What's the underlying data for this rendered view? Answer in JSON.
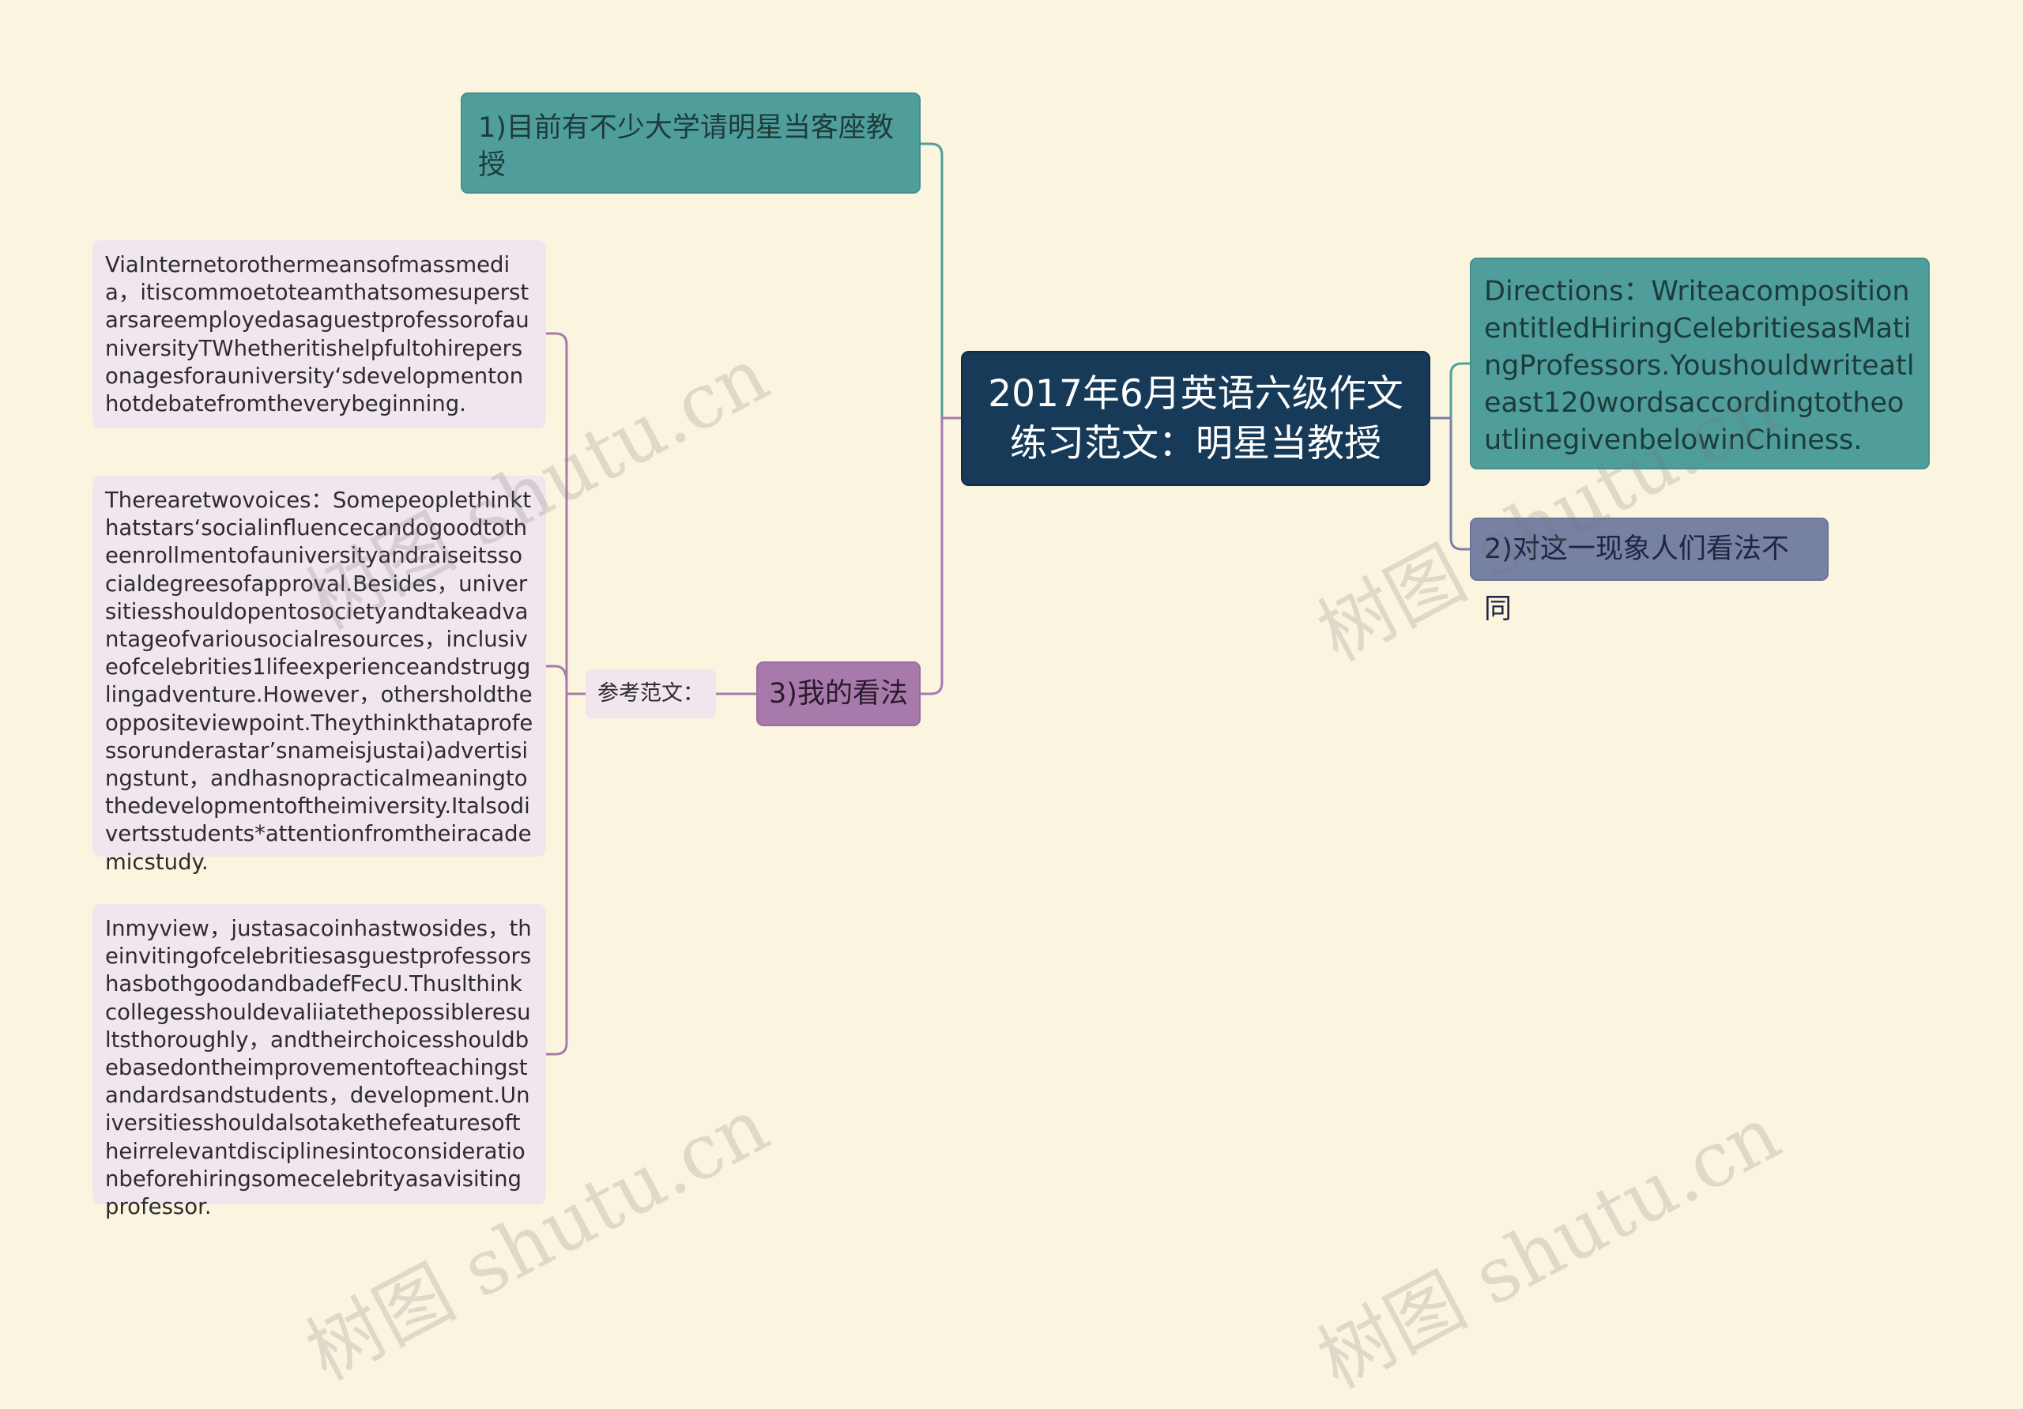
{
  "mindmap": {
    "central": "2017年6月英语六级作文练习范文：明星当教授",
    "topic1": "1)目前有不少大学请明星当客座教授",
    "directions": "Directions：WriteacompositionentitledHiringCelebritiesasMatingProfessors.Youshouldwriteatleast120wordsaccordingtotheoutlinegivenbelowinChiness.",
    "topic2": "2)对这一现象人们看法不同",
    "topic3": "3)我的看法",
    "sample_label": "参考范文：",
    "paragraphs": [
      "ViaInternetorothermeansofmassmedia，itiscommoetoteamthatsomesuperstarsareemployedasaguestprofessorofauniversityTWhetheritishelpfultohirepersonagesforauniversity‘sdevelopmentonhotdebatefromtheverybeginning.",
      "Therearetwovoices：Somepeoplethinkthatstars‘socialinfluencecandogoodtotheenrollmentofauniversityandraiseitssocialdegreesofapproval.Besides，universitiesshouldopentosocietyandtakeadvantageofvariousocialresources，inclusiveofcelebrities1lifeexperienceandstrugglingadventure.However，othersholdtheoppositeviewpoint.Theythinkthataprofessorunderastar’snameisjustai)advertisingstunt，andhasnopracticalmeaningtothedevelopmentoftheimiversity.Italsodivertsstudents*attentionfromtheiracademicstudy.",
      "Inmyview，justasacoinhastwosides，theinvitingofcelebritiesasguestprofessorshasbothgoodandbadefFecU.Thuslthinkcollegesshouldevaliiatethepossibleresultsthoroughly，andtheirchoicesshouldbebasedontheimprovementofteachingstandardsandstudents，development.Universitiesshouldalsotakethefeaturesoftheirrelevantdisciplinesintoconsiderationbeforehiringsomecelebrityasavisitingprofessor."
    ]
  },
  "watermark": "树图 shutu.cn",
  "colors": {
    "background": "#fbf5e0",
    "central": "#173a58",
    "teal": "#4f9e9c",
    "slate": "#7781a3",
    "purple": "#a87aac",
    "leaf": "#f1e5ee"
  }
}
